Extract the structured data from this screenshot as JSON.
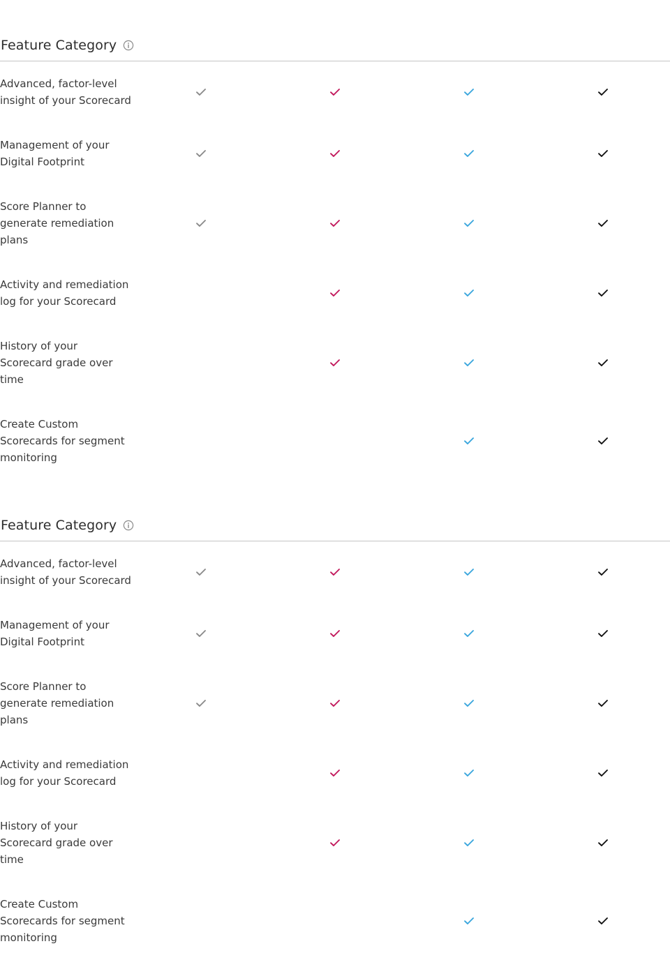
{
  "tiers": [
    {
      "name": "tier-1",
      "color": "#8a8a8a"
    },
    {
      "name": "tier-2",
      "color": "#c2185b"
    },
    {
      "name": "tier-3",
      "color": "#3aa6dd"
    },
    {
      "name": "tier-4",
      "color": "#111111"
    }
  ],
  "sections": [
    {
      "title": "Feature Category",
      "info_icon": "info-circle-icon",
      "rows": [
        {
          "label": "Advanced, factor-level\ninsight of your Scorecard",
          "checks": [
            true,
            true,
            true,
            true
          ]
        },
        {
          "label": "Management of your\nDigital Footprint",
          "checks": [
            true,
            true,
            true,
            true
          ]
        },
        {
          "label": "Score Planner to\ngenerate remediation\nplans",
          "checks": [
            true,
            true,
            true,
            true
          ]
        },
        {
          "label": "Activity and remediation\nlog for your Scorecard",
          "checks": [
            false,
            true,
            true,
            true
          ]
        },
        {
          "label": "History of your\nScorecard grade over\ntime",
          "checks": [
            false,
            true,
            true,
            true
          ]
        },
        {
          "label": "Create Custom\nScorecards for segment\nmonitoring",
          "checks": [
            false,
            false,
            true,
            true
          ]
        }
      ]
    },
    {
      "title": "Feature Category",
      "info_icon": "info-circle-icon",
      "rows": [
        {
          "label": "Advanced, factor-level\ninsight of your Scorecard",
          "checks": [
            true,
            true,
            true,
            true
          ]
        },
        {
          "label": "Management of your\nDigital Footprint",
          "checks": [
            true,
            true,
            true,
            true
          ]
        },
        {
          "label": "Score Planner to\ngenerate remediation\nplans",
          "checks": [
            true,
            true,
            true,
            true
          ]
        },
        {
          "label": "Activity and remediation\nlog for your Scorecard",
          "checks": [
            false,
            true,
            true,
            true
          ]
        },
        {
          "label": "History of your\nScorecard grade over\ntime",
          "checks": [
            false,
            true,
            true,
            true
          ]
        },
        {
          "label": "Create Custom\nScorecards for segment\nmonitoring",
          "checks": [
            false,
            false,
            true,
            true
          ]
        }
      ]
    }
  ]
}
